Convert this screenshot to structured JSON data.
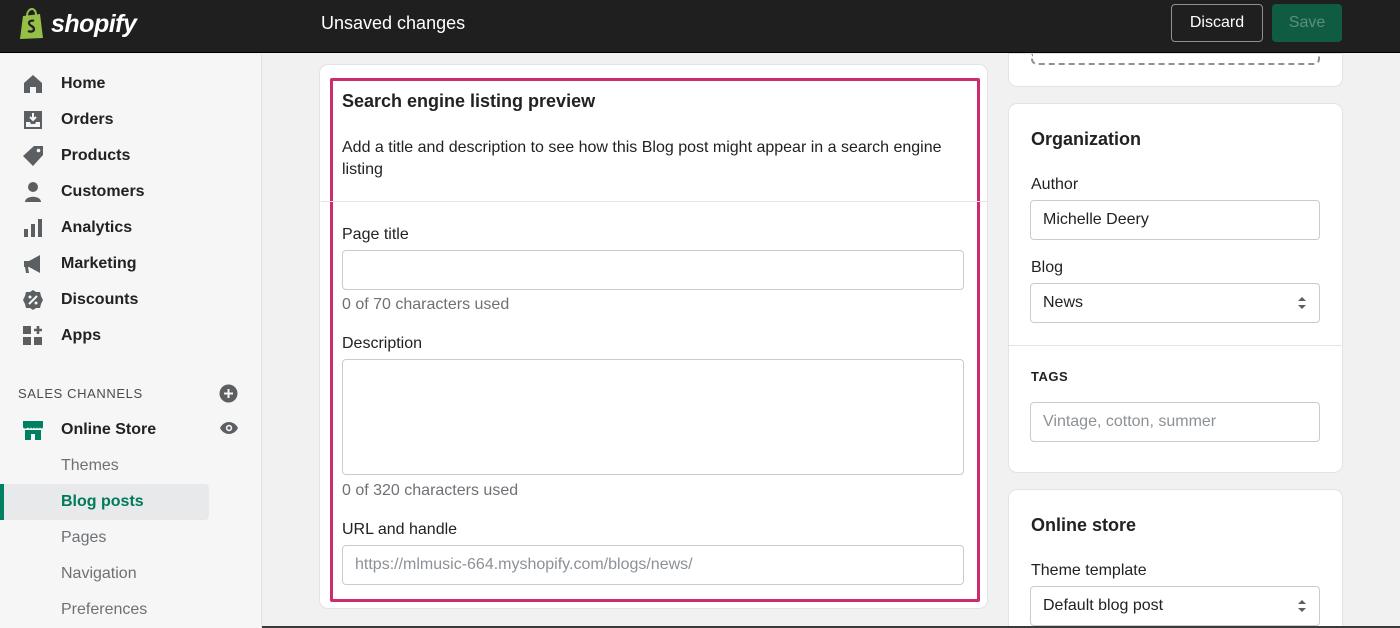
{
  "topbar": {
    "brand": "shopify",
    "status": "Unsaved changes",
    "discard_label": "Discard",
    "save_label": "Save"
  },
  "sidebar": {
    "items": [
      {
        "label": "Home",
        "icon": "home-icon"
      },
      {
        "label": "Orders",
        "icon": "orders-icon"
      },
      {
        "label": "Products",
        "icon": "tag-icon"
      },
      {
        "label": "Customers",
        "icon": "person-icon"
      },
      {
        "label": "Analytics",
        "icon": "bar-chart-icon"
      },
      {
        "label": "Marketing",
        "icon": "megaphone-icon"
      },
      {
        "label": "Discounts",
        "icon": "discount-icon"
      },
      {
        "label": "Apps",
        "icon": "apps-icon"
      }
    ],
    "sales_channels_label": "SALES CHANNELS",
    "online_store_label": "Online Store",
    "sub_items": [
      "Themes",
      "Blog posts",
      "Pages",
      "Navigation",
      "Preferences"
    ],
    "active_sub_item": "Blog posts"
  },
  "seo": {
    "title": "Search engine listing preview",
    "description": "Add a title and description to see how this Blog post might appear in a search engine listing",
    "page_title_label": "Page title",
    "page_title_value": "",
    "page_title_help": "0 of 70 characters used",
    "description_label": "Description",
    "description_value": "",
    "description_help": "0 of 320 characters used",
    "url_label": "URL and handle",
    "url_placeholder": "https://mlmusic-664.myshopify.com/blogs/news/"
  },
  "organization": {
    "title": "Organization",
    "author_label": "Author",
    "author_value": "Michelle Deery",
    "blog_label": "Blog",
    "blog_value": "News",
    "tags_label": "TAGS",
    "tags_placeholder": "Vintage, cotton, summer"
  },
  "online_store": {
    "title": "Online store",
    "template_label": "Theme template",
    "template_value": "Default blog post"
  },
  "colors": {
    "topbar": "#1f1f1f",
    "accent_green": "#008060",
    "highlight": "#cc2b6d"
  }
}
